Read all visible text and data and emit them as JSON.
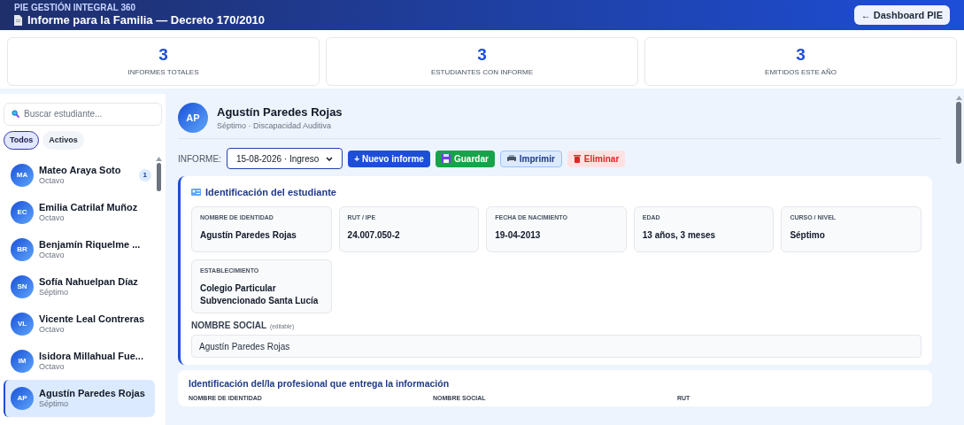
{
  "header": {
    "app_name": "PIE GESTIÓN INTEGRAL 360",
    "title": "Informe para la Familia — Decreto 170/2010",
    "back_button": "← Dashboard PIE"
  },
  "stats": [
    {
      "value": "3",
      "label": "INFORMES TOTALES"
    },
    {
      "value": "3",
      "label": "ESTUDIANTES CON INFORME"
    },
    {
      "value": "3",
      "label": "EMITIDOS ESTE AÑO"
    }
  ],
  "sidebar": {
    "search_placeholder": "Buscar estudiante...",
    "filters": [
      {
        "label": "Todos",
        "selected": true
      },
      {
        "label": "Activos",
        "selected": false
      }
    ],
    "students": [
      {
        "initials": "MA",
        "name": "Mateo Araya Soto",
        "course": "Octavo",
        "badge": "1",
        "selected": false
      },
      {
        "initials": "EC",
        "name": "Emilia Catrilaf Muñoz",
        "course": "Octavo",
        "selected": false
      },
      {
        "initials": "BR",
        "name": "Benjamín Riquelme ...",
        "course": "Octavo",
        "selected": false
      },
      {
        "initials": "SN",
        "name": "Sofía Nahuelpan Díaz",
        "course": "Séptimo",
        "selected": false
      },
      {
        "initials": "VL",
        "name": "Vicente Leal Contreras",
        "course": "Octavo",
        "selected": false
      },
      {
        "initials": "IM",
        "name": "Isidora Millahual Fue...",
        "course": "Octavo",
        "selected": false
      },
      {
        "initials": "AP",
        "name": "Agustín Paredes Rojas",
        "course": "Séptimo",
        "selected": true
      }
    ]
  },
  "student": {
    "initials": "AP",
    "name": "Agustín Paredes Rojas",
    "subtitle": "Séptimo · Discapacidad Auditiva"
  },
  "toolbar": {
    "label": "INFORME:",
    "report_select": "15-08-2026 · Ingreso",
    "buttons": [
      {
        "kind": "primary",
        "label": "+ Nuevo informe"
      },
      {
        "kind": "save",
        "label": "Guardar"
      },
      {
        "kind": "print",
        "label": "Imprimir"
      },
      {
        "kind": "delete",
        "label": "Eliminar"
      }
    ]
  },
  "identification": {
    "title": "Identificación del estudiante",
    "fields": [
      {
        "label": "NOMBRE DE IDENTIDAD",
        "value": "Agustín Paredes Rojas"
      },
      {
        "label": "RUT / IPE",
        "value": "24.007.050-2"
      },
      {
        "label": "FECHA DE NACIMIENTO",
        "value": "19-04-2013"
      },
      {
        "label": "EDAD",
        "value": "13 años, 3 meses"
      },
      {
        "label": "CURSO / NIVEL",
        "value": "Séptimo"
      },
      {
        "label": "ESTABLECIMIENTO",
        "value": "Colegio Particular Subvencionado Santa Lucía"
      }
    ],
    "social_name_label": "NOMBRE SOCIAL",
    "social_name_hint": "(editable)",
    "social_name_value": "Agustín Paredes Rojas"
  },
  "professional": {
    "title": "Identificación del/la profesional que entrega la información",
    "columns": [
      "NOMBRE DE IDENTIDAD",
      "NOMBRE SOCIAL",
      "RUT"
    ]
  }
}
